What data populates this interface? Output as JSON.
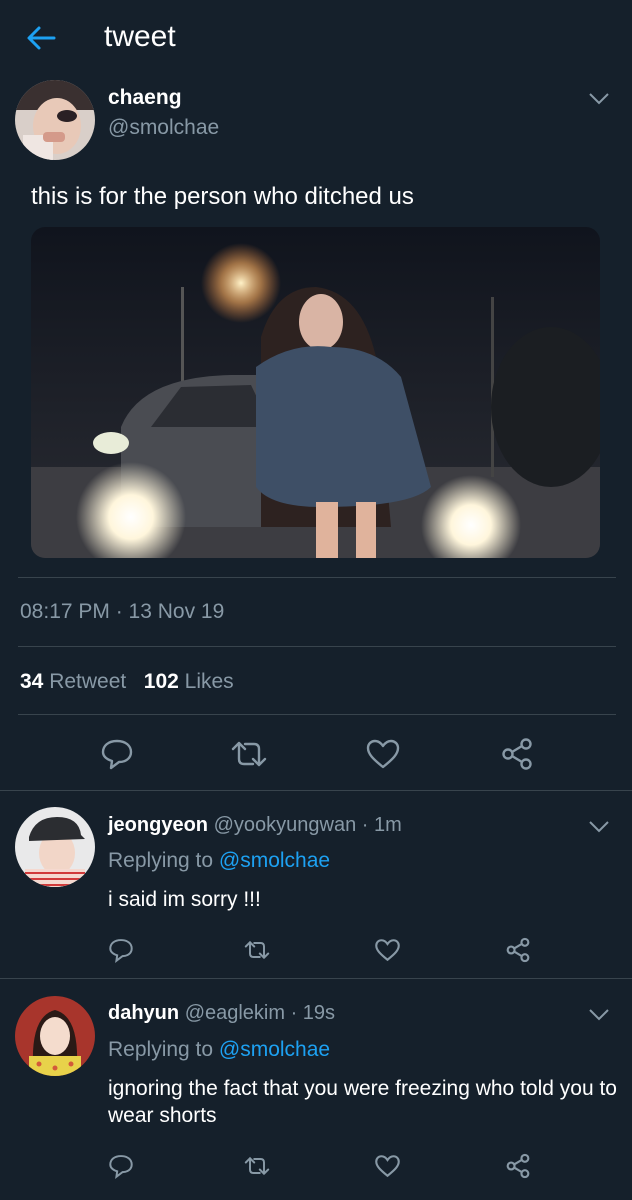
{
  "header": {
    "title": "tweet",
    "back_icon": "arrow-left-icon"
  },
  "tweet": {
    "author_name": "chaeng",
    "author_handle": "@smolchae",
    "text": "this is for the person who ditched us",
    "timestamp": "08:17 PM · 13 Nov 19",
    "retweet_count": "34",
    "retweet_label": "Retweet",
    "like_count": "102",
    "like_label": "Likes",
    "actions": [
      "reply-icon",
      "retweet-icon",
      "like-icon",
      "share-icon"
    ]
  },
  "replies": [
    {
      "name": "jeongyeon",
      "handle": "@yookyungwan",
      "time": "· 1m",
      "replying_prefix": "Replying to",
      "replying_to": "@smolchae",
      "text": "i said im sorry !!!"
    },
    {
      "name": "dahyun",
      "handle": "@eaglekim",
      "time": "· 19s",
      "replying_prefix": "Replying to",
      "replying_to": "@smolchae",
      "text": "ignoring the fact that you were freezing who told you to wear shorts"
    }
  ],
  "colors": {
    "background": "#15202b",
    "accent": "#1da1f2",
    "muted": "#8899a6",
    "divider": "#38444d"
  }
}
